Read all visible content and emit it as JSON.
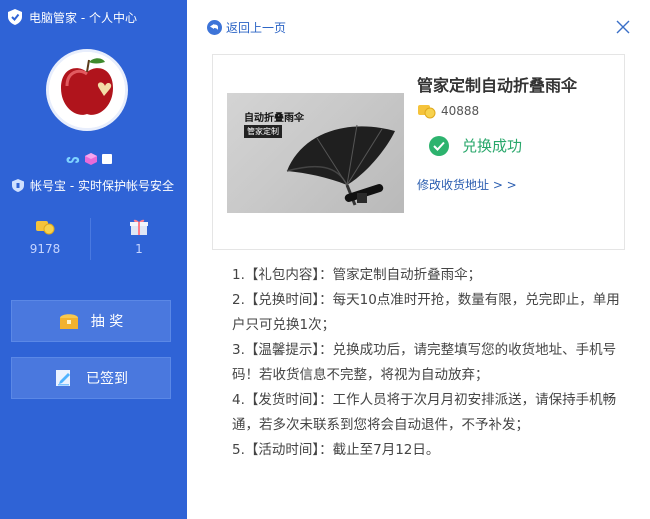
{
  "sidebar": {
    "app_title": "电脑管家 - 个人中心",
    "account_safe_text": "帐号宝 - 实时保护帐号安全",
    "stats": [
      {
        "icon": "coins-icon",
        "value": "9178"
      },
      {
        "icon": "gift-icon",
        "value": "1"
      }
    ],
    "lottery_label": "抽 奖",
    "signed_label": "已签到"
  },
  "main": {
    "back_label": "返回上一页",
    "product": {
      "name": "管家定制自动折叠雨伞",
      "image_title": "自动折叠雨伞",
      "image_tag": "管家定制",
      "points": "40888",
      "status": "兑换成功",
      "modify_link": "修改收货地址 > >"
    },
    "rules": [
      "1.【礼包内容】：管家定制自动折叠雨伞；",
      "2.【兑换时间】：每天10点准时开抢，数量有限，兑完即止，单用户只可兑换1次；",
      "3.【温馨提示】：兑换成功后，请完整填写您的收货地址、手机号码！若收货信息不完整，将视为自动放弃；",
      "4.【发货时间】：工作人员将于次月月初安排派送，请保持手机畅通，若多次未联系到您将会自动退件，不予补发；",
      "5.【活动时间】：截止至7月12日。"
    ]
  },
  "colors": {
    "sidebar_bg": "#2f63d6",
    "success_green": "#2db36e",
    "link_blue": "#2b64c5"
  }
}
